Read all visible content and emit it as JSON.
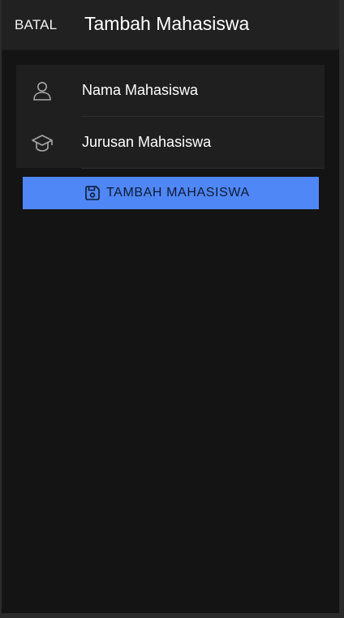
{
  "header": {
    "cancel_label": "BATAL",
    "title": "Tambah Mahasiswa"
  },
  "form": {
    "fields": [
      {
        "label": "Nama Mahasiswa",
        "icon": "person-icon"
      },
      {
        "label": "Jurusan Mahasiswa",
        "icon": "graduation-cap-icon"
      }
    ]
  },
  "submit": {
    "label": "TAMBAH MAHASISWA",
    "icon": "floppy-disk-icon",
    "color": "#4f87f7"
  },
  "colors": {
    "background": "#141414",
    "header": "#212121",
    "card": "#1f1f1f"
  }
}
